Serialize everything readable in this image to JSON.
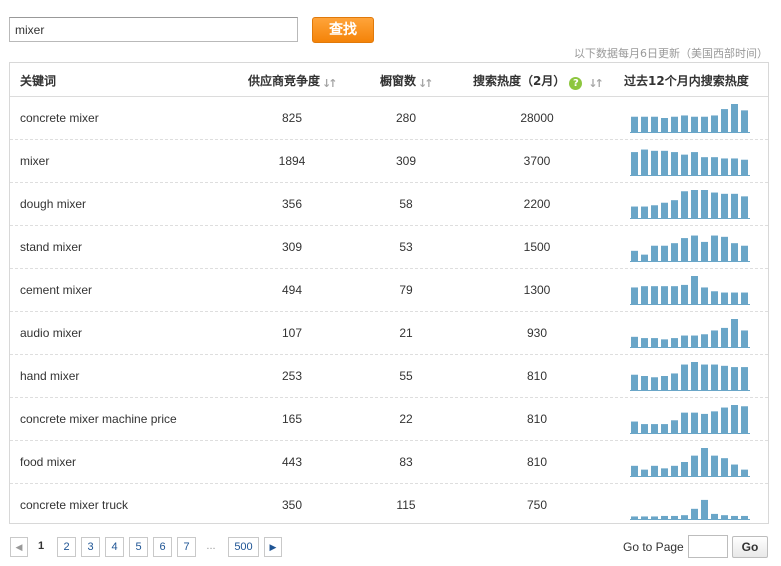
{
  "search": {
    "value": "mixer",
    "button_label": "查找"
  },
  "update_note": "以下数据每月6日更新（美国西部时间）",
  "table": {
    "headers": {
      "keyword": "关键词",
      "supplier": "供应商竞争度",
      "window": "橱窗数",
      "search": "搜索热度（2月）",
      "trend": "过去12个月内搜索热度"
    },
    "rows": [
      {
        "keyword": "concrete mixer",
        "supplier": "825",
        "window": "280",
        "search": "28000",
        "trend": [
          6,
          6,
          6,
          5.5,
          6,
          6.5,
          6,
          6,
          6.5,
          9,
          11,
          8.5
        ]
      },
      {
        "keyword": "mixer",
        "supplier": "1894",
        "window": "309",
        "search": "3700",
        "trend": [
          9,
          10,
          9.5,
          9.5,
          9,
          8,
          9,
          7,
          7,
          6.5,
          6.5,
          6
        ]
      },
      {
        "keyword": "dough mixer",
        "supplier": "356",
        "window": "58",
        "search": "2200",
        "trend": [
          4.5,
          4.5,
          5,
          6,
          7,
          10.5,
          11,
          11,
          10,
          9.5,
          9.5,
          8.5
        ]
      },
      {
        "keyword": "stand mixer",
        "supplier": "309",
        "window": "53",
        "search": "1500",
        "trend": [
          4,
          2.5,
          6,
          6,
          7,
          9,
          10,
          7.5,
          10,
          9.5,
          7,
          6
        ]
      },
      {
        "keyword": "cement mixer",
        "supplier": "494",
        "window": "79",
        "search": "1300",
        "trend": [
          6.5,
          7,
          7,
          7,
          7,
          7.5,
          11,
          6.5,
          5,
          4.5,
          4.5,
          4.5
        ]
      },
      {
        "keyword": "audio mixer",
        "supplier": "107",
        "window": "21",
        "search": "930",
        "trend": [
          4,
          3.5,
          3.5,
          3,
          3.5,
          4.5,
          4.5,
          5,
          6.5,
          7.5,
          11,
          6.5
        ]
      },
      {
        "keyword": "hand mixer",
        "supplier": "253",
        "window": "55",
        "search": "810",
        "trend": [
          6,
          5.5,
          5,
          5.5,
          6.5,
          10,
          11,
          10,
          10,
          9.5,
          9,
          9
        ]
      },
      {
        "keyword": "concrete mixer machine price",
        "supplier": "165",
        "window": "22",
        "search": "810",
        "trend": [
          4.5,
          3.5,
          3.5,
          3.5,
          5,
          8,
          8,
          7.5,
          8.5,
          10,
          11,
          10.5
        ]
      },
      {
        "keyword": "food mixer",
        "supplier": "443",
        "window": "83",
        "search": "810",
        "trend": [
          4,
          2.5,
          4,
          3,
          4,
          5.5,
          8,
          11,
          8,
          7,
          4.5,
          2.5
        ]
      },
      {
        "keyword": "concrete mixer truck",
        "supplier": "350",
        "window": "115",
        "search": "750",
        "trend": [
          1,
          1,
          1,
          1.2,
          1.2,
          1.5,
          4,
          7.5,
          2,
          1.5,
          1.2,
          1.2
        ]
      }
    ]
  },
  "pagination": {
    "prev": "◀",
    "current": "1",
    "pages": [
      "2",
      "3",
      "4",
      "5",
      "6",
      "7"
    ],
    "ellipsis": "...",
    "last": "500",
    "next": "▶"
  },
  "goto": {
    "label": "Go to Page",
    "value": "",
    "button_label": "Go"
  },
  "colors": {
    "bar": "#6aa6c8",
    "accent_button": "#f48308",
    "link": "#1e5494",
    "help_icon": "#8dc63f"
  },
  "icons": {
    "sort": "sort-arrows-icon",
    "help": "question-mark-icon",
    "prev": "triangle-left-icon",
    "next": "triangle-right-icon"
  }
}
